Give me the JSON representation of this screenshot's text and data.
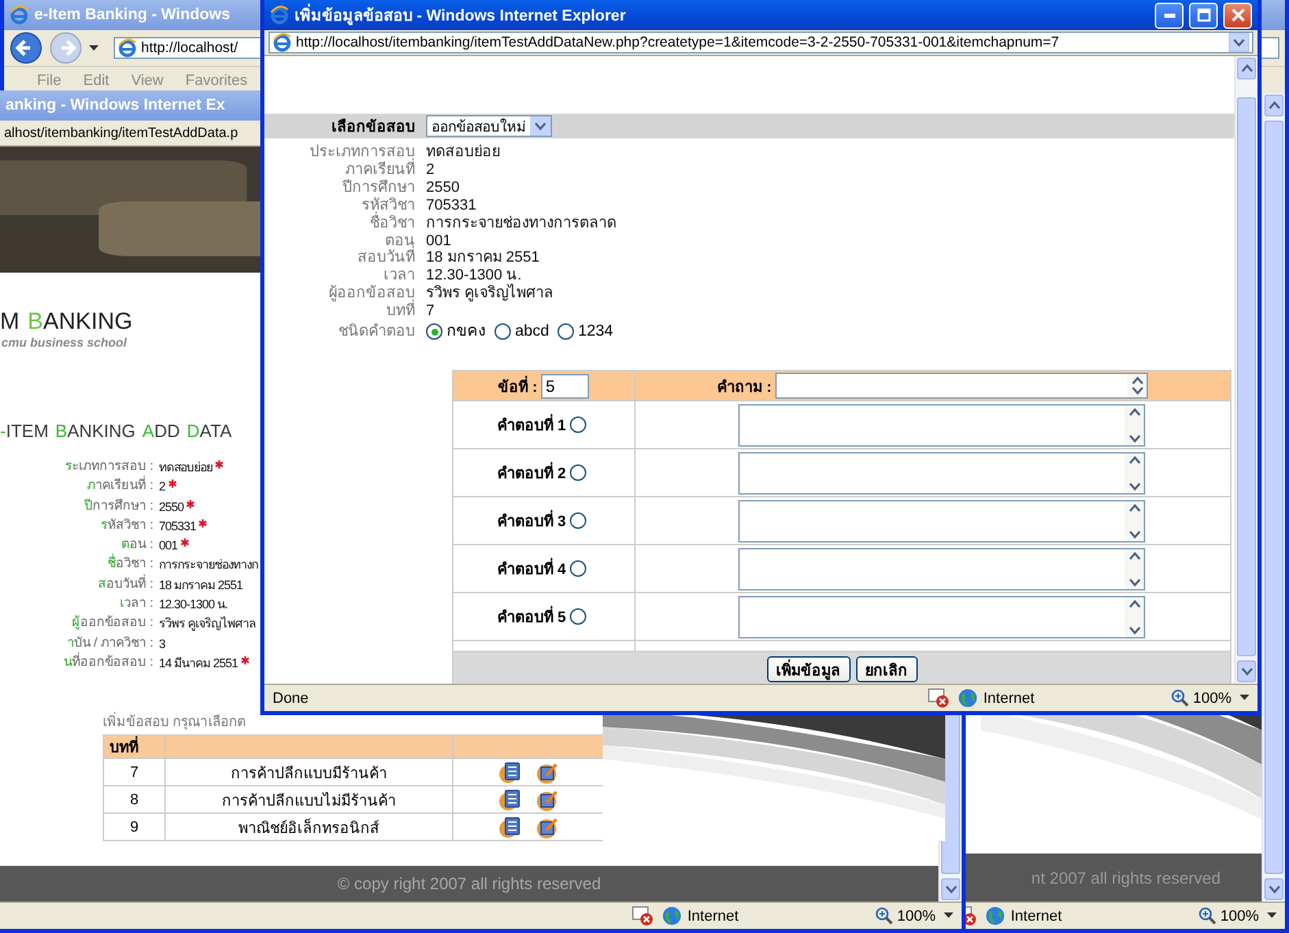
{
  "outer_window": {
    "title": "e-Item Banking - Windows",
    "address": "http://localhost/",
    "menu": [
      "File",
      "Edit",
      "View",
      "Favorites"
    ],
    "footer": "nt 2007 all rights reserved",
    "status": {
      "zone": "Internet",
      "zoom": "100%"
    }
  },
  "back_window": {
    "title": "anking - Windows Internet Ex",
    "address": "alhost/itembanking/itemTestAddData.p",
    "logo": {
      "words": [
        "M",
        "BANKING"
      ],
      "tagline": "cmu business school"
    },
    "heading": [
      "-ITEM",
      "BANKING",
      "ADD",
      "DATA"
    ],
    "fields": [
      {
        "label": "ระเภทการสอบ :",
        "value": "ทดสอบย่อย",
        "required": true
      },
      {
        "label": "ภาคเรียนที่ :",
        "value": "2",
        "required": true
      },
      {
        "label": "ปีการศึกษา :",
        "value": "2550",
        "required": true
      },
      {
        "label": "รหัสวิชา :",
        "value": "705331",
        "required": true
      },
      {
        "label": "ตอน :",
        "value": "001",
        "required": true
      },
      {
        "label": "ชื่อวิชา :",
        "value": "การกระจายช่องทางก",
        "required": false
      },
      {
        "label": "สอบวันที่ :",
        "value": "18 มกราคม  2551",
        "required": false
      },
      {
        "label": "เวลา :",
        "value": "12.30-1300 น.",
        "required": false
      },
      {
        "label": "ผู้ออกข้อสอบ :",
        "value": "รวิพร คูเจริญไพศาล",
        "required": false
      },
      {
        "label": "าบัน / ภาควิชา :",
        "value": "3",
        "required": false
      },
      {
        "label": "นที่ออกข้อสอบ :",
        "value": "14 มีนาคม 2551",
        "required": true
      }
    ],
    "table": {
      "caption": "เพิ่มข้อสอบ กรุณาเลือกต",
      "columns": [
        "บทที่"
      ],
      "rows": [
        {
          "chapter": "7",
          "title": "การค้าปลีกแบบมีร้านค้า"
        },
        {
          "chapter": "8",
          "title": "การค้าปลีกแบบไม่มีร้านค้า"
        },
        {
          "chapter": "9",
          "title": "พาณิชย์อิเล็กทรอนิกส์"
        }
      ]
    },
    "footer": "© copy right 2007 all rights reserved",
    "status": {
      "zone": "Internet",
      "zoom": "100%"
    }
  },
  "popup": {
    "title": "เพิ่มข้อมูลข้อสอบ - Windows Internet Explorer",
    "address": "http://localhost/itembanking/itemTestAddDataNew.php?createtype=1&itemcode=3-2-2550-705331-001&itemchapnum=7",
    "select": {
      "label": "เลือกข้อสอบ",
      "value": "ออกข้อสอบใหม่"
    },
    "fields": [
      {
        "label": "ประเภทการสอบ",
        "value": "ทดสอบย่อย"
      },
      {
        "label": "ภาคเรียนที่",
        "value": "2"
      },
      {
        "label": "ปีการศึกษา",
        "value": "2550"
      },
      {
        "label": "รหัสวิชา",
        "value": "705331"
      },
      {
        "label": "ชื่อวิชา",
        "value": "การกระจายช่องทางการตลาด"
      },
      {
        "label": "ตอน",
        "value": "001"
      },
      {
        "label": "สอบวันที่",
        "value": "18 มกราคม  2551"
      },
      {
        "label": "เวลา",
        "value": "12.30-1300 น."
      },
      {
        "label": "ผู้ออกข้อสอบ",
        "value": "รวิพร คูเจริญไพศาล"
      },
      {
        "label": "บทที่",
        "value": "7"
      }
    ],
    "answer_type": {
      "label": "ชนิดคำตอบ",
      "options": [
        {
          "label": "กขคง",
          "selected": true
        },
        {
          "label": "abcd",
          "selected": false
        },
        {
          "label": "1234",
          "selected": false
        }
      ]
    },
    "question": {
      "number_label": "ข้อที่ :",
      "number": "5",
      "question_label": "คำถาม :"
    },
    "answers": [
      {
        "label": "คำตอบที่ 1",
        "selected": false
      },
      {
        "label": "คำตอบที่ 2",
        "selected": false
      },
      {
        "label": "คำตอบที่ 3",
        "selected": false
      },
      {
        "label": "คำตอบที่ 4",
        "selected": false
      },
      {
        "label": "คำตอบที่ 5",
        "selected": false
      }
    ],
    "buttons": [
      "เพิ่มข้อมูล",
      "ยกเลิก"
    ],
    "status": {
      "text": "Done",
      "zone": "Internet",
      "zoom": "100%"
    }
  }
}
